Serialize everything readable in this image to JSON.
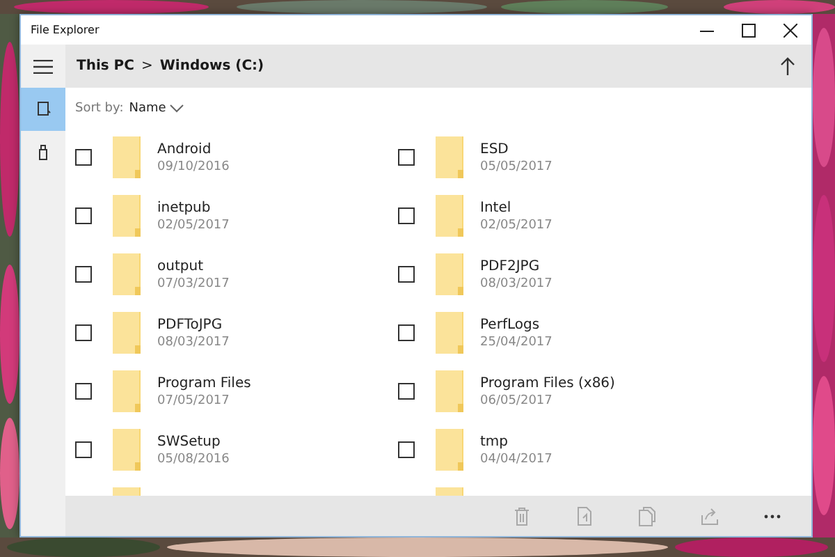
{
  "window": {
    "title": "File Explorer"
  },
  "address_bar": {
    "crumbs": [
      "This PC",
      "Windows (C:)"
    ],
    "separator": ">"
  },
  "sidebar": {
    "items": [
      {
        "kind": "device",
        "selected": true
      },
      {
        "kind": "usb",
        "selected": false
      }
    ]
  },
  "sort": {
    "label": "Sort by:",
    "value": "Name"
  },
  "items": [
    {
      "kind": "folder",
      "name": "Android",
      "date": "09/10/2016",
      "checked": false
    },
    {
      "kind": "folder",
      "name": "ESD",
      "date": "05/05/2017",
      "checked": false
    },
    {
      "kind": "folder",
      "name": "inetpub",
      "date": "02/05/2017",
      "checked": false
    },
    {
      "kind": "folder",
      "name": "Intel",
      "date": "02/05/2017",
      "checked": false
    },
    {
      "kind": "folder",
      "name": "output",
      "date": "07/03/2017",
      "checked": false
    },
    {
      "kind": "folder",
      "name": "PDF2JPG",
      "date": "08/03/2017",
      "checked": false
    },
    {
      "kind": "folder",
      "name": "PDFToJPG",
      "date": "08/03/2017",
      "checked": false
    },
    {
      "kind": "folder",
      "name": "PerfLogs",
      "date": "25/04/2017",
      "checked": false
    },
    {
      "kind": "folder",
      "name": "Program Files",
      "date": "07/05/2017",
      "checked": false
    },
    {
      "kind": "folder",
      "name": "Program Files (x86)",
      "date": "06/05/2017",
      "checked": false
    },
    {
      "kind": "folder",
      "name": "SWSetup",
      "date": "05/08/2016",
      "checked": false
    },
    {
      "kind": "folder",
      "name": "tmp",
      "date": "04/04/2017",
      "checked": false
    },
    {
      "kind": "partial"
    },
    {
      "kind": "partial"
    }
  ],
  "command_bar": [
    {
      "kind": "delete",
      "disabled": true
    },
    {
      "kind": "rename",
      "disabled": true
    },
    {
      "kind": "copy",
      "disabled": true
    },
    {
      "kind": "share",
      "disabled": true
    },
    {
      "kind": "more",
      "disabled": false
    }
  ]
}
